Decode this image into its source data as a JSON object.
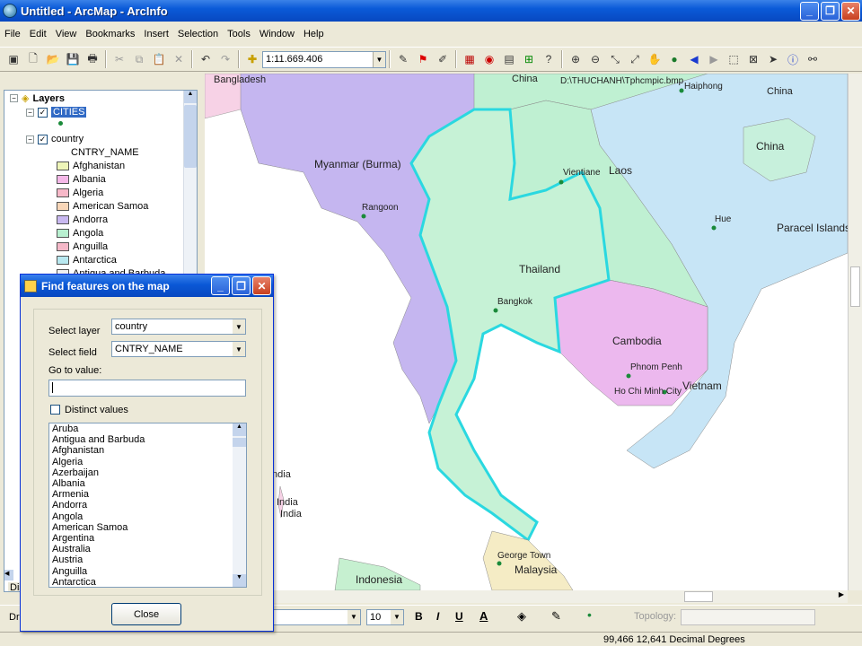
{
  "window": {
    "title": "Untitled - ArcMap - ArcInfo"
  },
  "menu": [
    "File",
    "Edit",
    "View",
    "Bookmarks",
    "Insert",
    "Selection",
    "Tools",
    "Window",
    "Help"
  ],
  "toolbar": {
    "scale": "1:11.669.406"
  },
  "toc": {
    "root": "Layers",
    "layer1": "CITIES",
    "layer2": "country",
    "field": "CNTRY_NAME",
    "legend": [
      {
        "name": "Afghanistan",
        "color": "#eef5b8"
      },
      {
        "name": "Albania",
        "color": "#f5b8e8"
      },
      {
        "name": "Algeria",
        "color": "#f7b8c8"
      },
      {
        "name": "American Samoa",
        "color": "#f8d6b8"
      },
      {
        "name": "Andorra",
        "color": "#c8b8f0"
      },
      {
        "name": "Angola",
        "color": "#b8f0d0"
      },
      {
        "name": "Anguilla",
        "color": "#f5b8c8"
      },
      {
        "name": "Antarctica",
        "color": "#b8e8f0"
      }
    ],
    "partial": "Antigua and Barbuda",
    "tab_display": "Dis"
  },
  "dialog": {
    "title": "Find features on the map",
    "select_layer_label": "Select layer",
    "select_layer_value": "country",
    "select_field_label": "Select field",
    "select_field_value": "CNTRY_NAME",
    "goto_label": "Go to value:",
    "goto_value": "",
    "distinct_label": "Distinct values",
    "values": [
      "Aruba",
      "Antigua and Barbuda",
      "Afghanistan",
      "Algeria",
      "Azerbaijan",
      "Albania",
      "Armenia",
      "Andorra",
      "Angola",
      "American Samoa",
      "Argentina",
      "Australia",
      "Austria",
      "Anguilla",
      "Antarctica"
    ],
    "close_label": "Close"
  },
  "map": {
    "countries": [
      "Bangladesh",
      "China",
      "Myanmar (Burma)",
      "Laos",
      "Thailand",
      "Cambodia",
      "Vietnam",
      "Malaysia",
      "Indonesia",
      "India",
      "Paracel Islands"
    ],
    "cities": [
      "Vientiane",
      "Rangoon",
      "Hue",
      "Bangkok",
      "Phnom Penh",
      "Ho Chi Minh City",
      "George Town",
      "Haiphong"
    ],
    "china_labels": [
      "China",
      "China",
      "China"
    ],
    "india_labels": [
      "India",
      "India",
      "India"
    ],
    "path_label": "D:\\THUCHANH\\Tphcmpic.bmp"
  },
  "drawbar": {
    "draw": "Dra",
    "font_size": "10",
    "topology": "Topology:"
  },
  "status": {
    "coords": "99,466  12,641 Decimal Degrees"
  }
}
